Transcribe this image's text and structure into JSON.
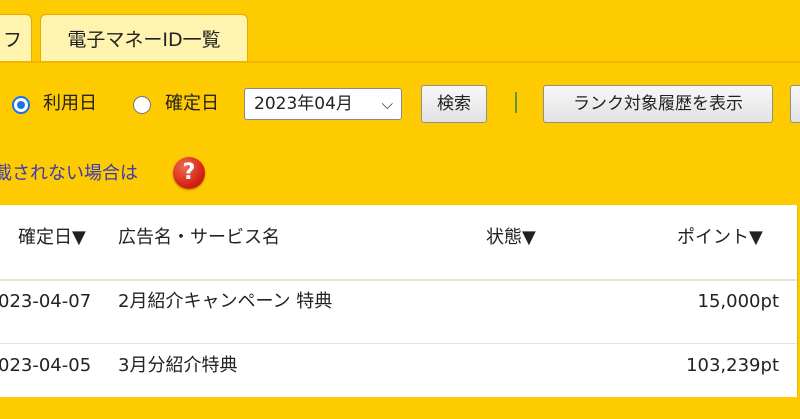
{
  "tabs": [
    {
      "label": "フ"
    },
    {
      "label": "電子マネーID一覧"
    }
  ],
  "filter": {
    "radio_usage_label": "利用日",
    "radio_confirmed_label": "確定日",
    "month_value": "2023年04月",
    "month_chevron": "⌵",
    "search_label": "検索",
    "rank_history_label": "ランク対象履歴を表示",
    "extra_button_label": ""
  },
  "help": {
    "link_text": "載されない場合は",
    "icon_glyph": "?"
  },
  "table": {
    "headers": [
      "確定日▼",
      "広告名・サービス名",
      "状態▼",
      "ポイント▼"
    ],
    "rows": [
      {
        "date": "023-04-07",
        "name": "2月紹介キャンペーン 特典",
        "status": "",
        "points": "15,000pt"
      },
      {
        "date": "023-04-05",
        "name": "3月分紹介特典",
        "status": "",
        "points": "103,239pt"
      }
    ]
  },
  "colors": {
    "background": "#fecb00",
    "tab_bg": "#fff3b0",
    "link": "#3a3ab8",
    "radio_checked": "#1a73e8",
    "help_icon": "#d11b0b"
  }
}
